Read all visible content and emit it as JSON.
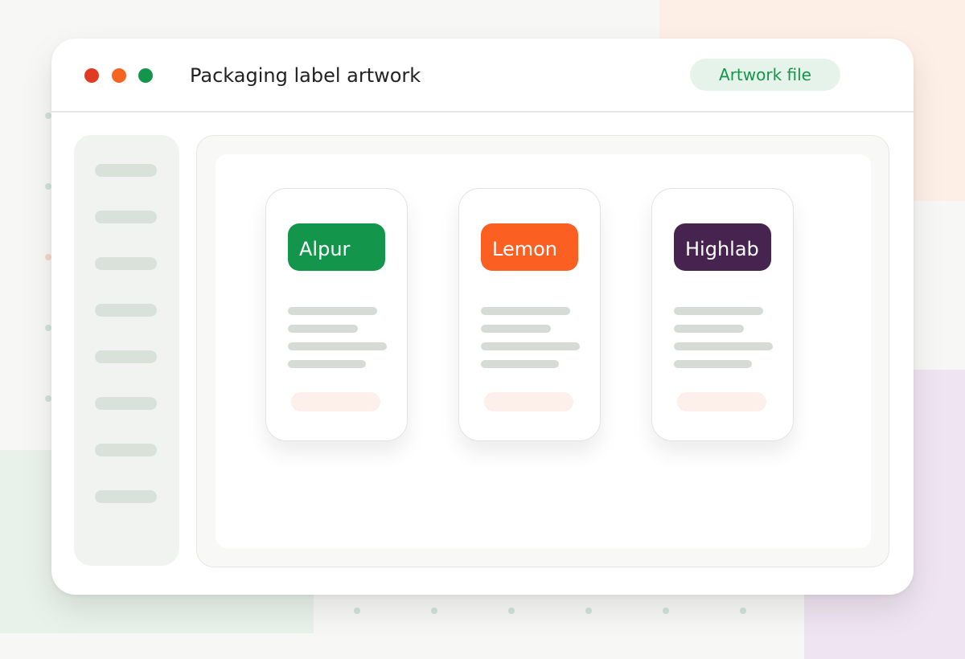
{
  "window": {
    "title": "Packaging label artwork",
    "badge_label": "Artwork file"
  },
  "cards": [
    {
      "brand": "Alpur",
      "color": "#13964b"
    },
    {
      "brand": "Lemon",
      "color": "#fb5f22"
    },
    {
      "brand": "Highlab",
      "color": "#47234f"
    }
  ],
  "colors": {
    "accent_green": "#13964b",
    "accent_orange": "#fb5f22",
    "accent_purple": "#47234f"
  }
}
